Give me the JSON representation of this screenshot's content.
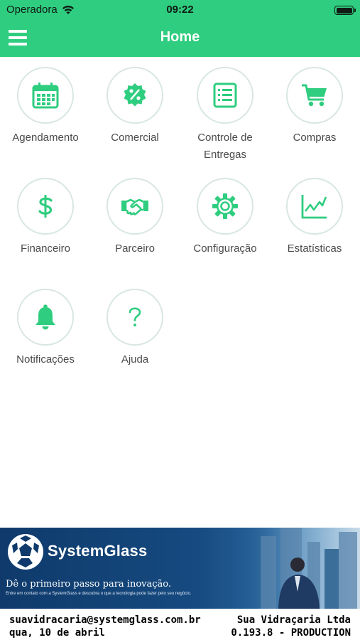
{
  "status_bar": {
    "carrier": "Operadora",
    "time": "09:22"
  },
  "nav": {
    "title": "Home",
    "menu_icon": "hamburger-menu-icon"
  },
  "accent_color": "#2fcd7f",
  "menu_items": [
    {
      "label": "Agendamento",
      "icon": "calendar-icon"
    },
    {
      "label": "Comercial",
      "icon": "discount-badge-icon"
    },
    {
      "label": "Controle de Entregas",
      "icon": "list-document-icon"
    },
    {
      "label": "Compras",
      "icon": "shopping-cart-icon"
    },
    {
      "label": "Financeiro",
      "icon": "dollar-icon"
    },
    {
      "label": "Parceiro",
      "icon": "handshake-icon"
    },
    {
      "label": "Configuração",
      "icon": "gear-icon"
    },
    {
      "label": "Estatísticas",
      "icon": "line-chart-icon"
    },
    {
      "label": "Notificações",
      "icon": "bell-icon"
    },
    {
      "label": "Ajuda",
      "icon": "question-icon"
    }
  ],
  "banner": {
    "brand": "SystemGlass",
    "tagline": "Dê o primeiro passo para inovação.",
    "subtext": "Entre em contato com a SystemGlass e descubra o que a tecnologia pode fazer pelo seu negócio."
  },
  "footer": {
    "email": "suavidracaria@systemglass.com.br",
    "company": "Sua Vidraçaria Ltda",
    "date": "qua, 10 de abril",
    "version": "0.193.8 - PRODUCTION"
  }
}
